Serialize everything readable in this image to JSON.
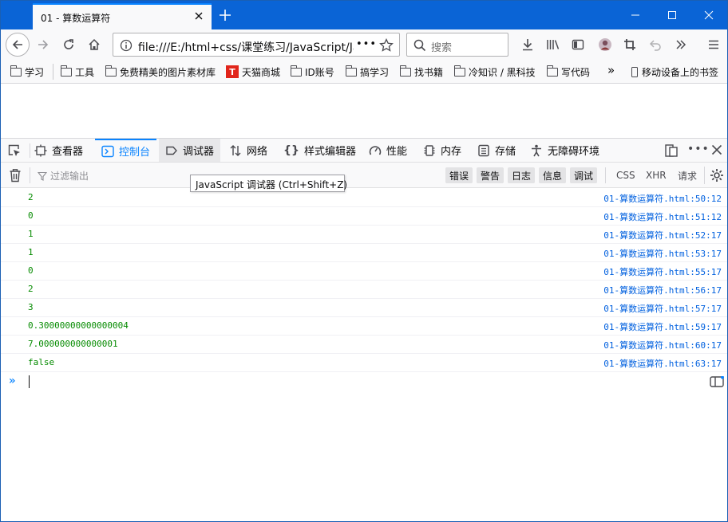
{
  "window": {
    "tab_title": "01 - 算数运算符",
    "controls": [
      "minimize",
      "maximize",
      "close"
    ]
  },
  "navbar": {
    "url": "file:///E:/html+css/课堂练习/JavaScript/Ja",
    "search_placeholder": "搜索",
    "more_label": "•••"
  },
  "bookmarks": {
    "items": [
      {
        "label": "学习",
        "icon": "folder-icon"
      },
      {
        "label": "工具",
        "icon": "folder-icon"
      },
      {
        "label": "免费精美的图片素材库",
        "icon": "folder-icon"
      },
      {
        "label": "天猫商城",
        "icon": "tmall-icon"
      },
      {
        "label": "ID账号",
        "icon": "folder-icon"
      },
      {
        "label": "搞学习",
        "icon": "folder-icon"
      },
      {
        "label": "找书籍",
        "icon": "folder-icon"
      },
      {
        "label": "冷知识 / 黑科技",
        "icon": "folder-icon"
      },
      {
        "label": "写代码",
        "icon": "folder-icon"
      }
    ],
    "overflow_label": "»",
    "mobile_label": "移动设备上的书签",
    "tmall_logo_text": "T"
  },
  "devtools": {
    "tabs": [
      {
        "label": "查看器",
        "icon": "inspector-icon"
      },
      {
        "label": "控制台",
        "icon": "console-icon"
      },
      {
        "label": "调试器",
        "icon": "debugger-icon"
      },
      {
        "label": "网络",
        "icon": "network-icon"
      },
      {
        "label": "样式编辑器",
        "icon": "style-editor-icon"
      },
      {
        "label": "性能",
        "icon": "performance-icon"
      },
      {
        "label": "内存",
        "icon": "memory-icon"
      },
      {
        "label": "存储",
        "icon": "storage-icon"
      },
      {
        "label": "无障碍环境",
        "icon": "accessibility-icon"
      }
    ],
    "active_tab": "控制台",
    "filter_placeholder": "过滤输出",
    "filter_chips": [
      "错误",
      "警告",
      "日志",
      "信息",
      "调试"
    ],
    "plain_chips": [
      "CSS",
      "XHR",
      "请求"
    ],
    "tooltip": "JavaScript 调试器 (Ctrl+Shift+Z)",
    "prompt": "»"
  },
  "console": {
    "rows": [
      {
        "value": "2",
        "source": "01-算数运算符.html:50:12"
      },
      {
        "value": "0",
        "source": "01-算数运算符.html:51:12"
      },
      {
        "value": "1",
        "source": "01-算数运算符.html:52:17"
      },
      {
        "value": "1",
        "source": "01-算数运算符.html:53:17"
      },
      {
        "value": "0",
        "source": "01-算数运算符.html:55:17"
      },
      {
        "value": "2",
        "source": "01-算数运算符.html:56:17"
      },
      {
        "value": "3",
        "source": "01-算数运算符.html:57:17"
      },
      {
        "value": "0.30000000000000004",
        "source": "01-算数运算符.html:59:17"
      },
      {
        "value": "7.000000000000001",
        "source": "01-算数运算符.html:60:17"
      },
      {
        "value": "false",
        "source": "01-算数运算符.html:63:17"
      }
    ]
  },
  "colors": {
    "titlebar": "#0a64d6",
    "accent": "#0a84ff",
    "log_value": "#058b00",
    "log_source": "#0060df"
  }
}
